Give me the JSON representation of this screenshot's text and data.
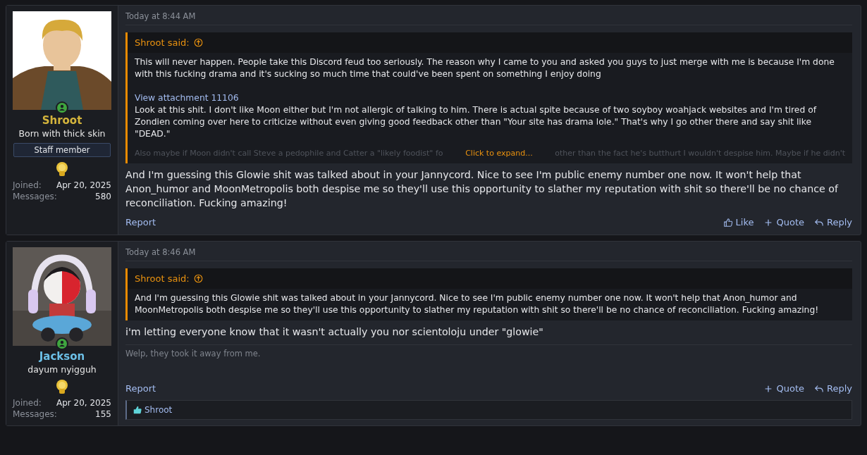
{
  "posts": [
    {
      "author": {
        "name": "Shroot",
        "color": "#d4b43c",
        "avatar": {
          "kind": "cartoon"
        },
        "online": true,
        "title": "Born with thick skin",
        "staff_badge": "Staff member",
        "stats": [
          {
            "label": "Joined:",
            "value": "Apr 20, 2025"
          },
          {
            "label": "Messages:",
            "value": "580"
          }
        ]
      },
      "time": "Today at 8:44 AM",
      "quote": {
        "author": "Shroot said:",
        "paragraphs": [
          {
            "kind": "text",
            "text": "This will never happen. People take this Discord feud too seriously. The reason why I came to you and asked you guys to just merge with me is because I'm done with this fucking drama and it's sucking so much time that could've been spent on something I enjoy doing"
          },
          {
            "kind": "link",
            "text": "View attachment 11106"
          },
          {
            "kind": "text",
            "text": "Look at this shit. I don't like Moon either but I'm not allergic of talking to him. There is actual spite because of two soyboy woahjack websites and I'm tired of Zondien coming over here to criticize without even giving good feedback other than \"Your site has drama lole.\" That's why I go other there and say shit like \"DEAD.\""
          },
          {
            "kind": "faded",
            "before": "Also maybe if Moon didn't call Steve a pedophile and Catter a \"likely foodist\" fo",
            "after": "other than the fact he's butthurt I wouldn't despise him. Maybe if he didn't"
          }
        ],
        "expand": "Click to expand..."
      },
      "body": "And I'm guessing this Glowie shit was talked about in your Jannycord. Nice to see I'm public enemy number one now. It won't help that Anon_humor and MoonMetropolis both despise me so they'll use this opportunity to slather my reputation with shit so there'll be no chance of reconciliation. Fucking amazing!",
      "report": "Report",
      "actions": [
        {
          "kind": "like",
          "label": "Like"
        },
        {
          "kind": "quote",
          "label": "Quote"
        },
        {
          "kind": "reply",
          "label": "Reply"
        }
      ]
    },
    {
      "author": {
        "name": "Jackson",
        "color": "#6cbfe6",
        "online": true,
        "title": "dayum nyigguh",
        "stats": [
          {
            "label": "Joined:",
            "value": "Apr 20, 2025"
          },
          {
            "label": "Messages:",
            "value": "155"
          }
        ]
      },
      "time": "Today at 8:46 AM",
      "quote": {
        "author": "Shroot said:",
        "paragraphs": [
          {
            "kind": "text",
            "text": "And I'm guessing this Glowie shit was talked about in your Jannycord. Nice to see I'm public enemy number one now. It won't help that Anon_humor and MoonMetropolis both despise me so they'll use this opportunity to slather my reputation with shit so there'll be no chance of reconciliation. Fucking amazing!"
          }
        ]
      },
      "body": "i'm letting everyone know that it wasn't actually you nor scientoloju under \"glowie\"",
      "signature": "Welp, they took it away from me.",
      "report": "Report",
      "actions": [
        {
          "kind": "quote",
          "label": "Quote"
        },
        {
          "kind": "reply",
          "label": "Reply"
        }
      ],
      "reactions": {
        "users": "Shroot"
      }
    }
  ]
}
